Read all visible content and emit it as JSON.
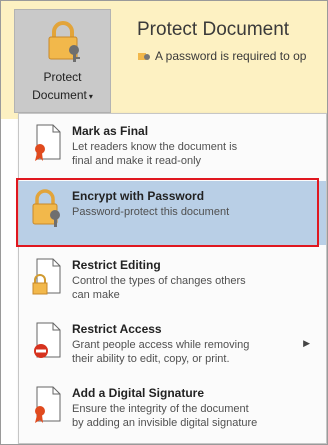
{
  "button": {
    "label_line1": "Protect",
    "label_line2": "Document",
    "caret": "▾"
  },
  "info": {
    "title": "Protect Document",
    "text": "A password is required to op"
  },
  "menu": {
    "items": [
      {
        "title": "Mark as Final",
        "desc1": "Let readers know the document is",
        "desc2": "final and make it read-only"
      },
      {
        "title": "Encrypt with Password",
        "desc1": "Password-protect this document",
        "desc2": ""
      },
      {
        "title": "Restrict Editing",
        "desc1": "Control the types of changes others",
        "desc2": "can make"
      },
      {
        "title": "Restrict Access",
        "desc1": "Grant people access while removing",
        "desc2": "their ability to edit, copy, or print."
      },
      {
        "title": "Add a Digital Signature",
        "desc1": "Ensure the integrity of the document",
        "desc2": "by adding an invisible digital signature"
      }
    ]
  },
  "colors": {
    "info_bar": "#fdf1c2",
    "highlight": "#b9cfe6",
    "highlight_border": "#e0171f"
  }
}
